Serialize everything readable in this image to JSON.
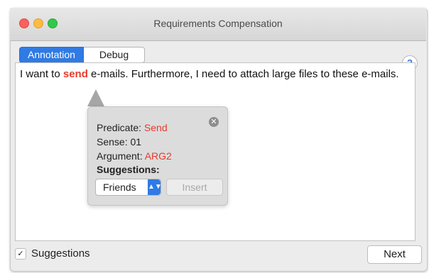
{
  "window": {
    "title": "Requirements Compensation"
  },
  "tabs": [
    {
      "label": "Annotation",
      "active": true
    },
    {
      "label": "Debug",
      "active": false
    }
  ],
  "help": {
    "label": "?"
  },
  "editor": {
    "text_before": "I want to ",
    "keyword": "send",
    "text_after": " e-mails. Furthermore, I need to attach large files to these e-mails."
  },
  "popover": {
    "close_symbol": "✕",
    "predicate_label": "Predicate: ",
    "predicate_value": "Send",
    "sense": "Sense: 01",
    "argument_label": "Argument: ",
    "argument_value": "ARG2",
    "suggestions_heading": "Suggestions:",
    "select_value": "Friends",
    "insert_label": "Insert"
  },
  "footer": {
    "suggestions_checked": true,
    "suggestions_label": "Suggestions",
    "next_label": "Next"
  },
  "colors": {
    "accent": "#2f7ae5",
    "highlight": "#e63b2e"
  }
}
